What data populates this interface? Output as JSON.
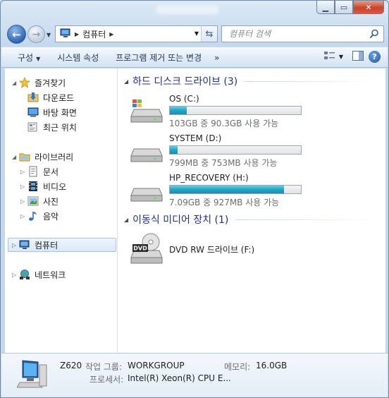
{
  "navigation": {
    "back_icon": "arrow-left",
    "forward_icon": "arrow-right",
    "address_crumb": "컴퓨터",
    "search_placeholder": "컴퓨터 검색"
  },
  "command_bar": {
    "organize": "구성",
    "system_properties": "시스템 속성",
    "uninstall_program": "프로그램 제거 또는 변경",
    "more": "»"
  },
  "nav_pane": {
    "favorites": {
      "label": "즐겨찾기",
      "items": [
        "다운로드",
        "바탕 화면",
        "최근 위치"
      ]
    },
    "libraries": {
      "label": "라이브러리",
      "items": [
        "문서",
        "비디오",
        "사진",
        "음악"
      ]
    },
    "computer": "컴퓨터",
    "network": "네트워크"
  },
  "groups": {
    "hard_disks": {
      "title": "하드 디스크 드라이브 (3)",
      "drives": [
        {
          "name": "OS (C:)",
          "info": "103GB 중 90.3GB 사용 가능",
          "used_fraction": 0.13
        },
        {
          "name": "SYSTEM (D:)",
          "info": "799MB 중 753MB 사용 가능",
          "used_fraction": 0.06
        },
        {
          "name": "HP_RECOVERY (H:)",
          "info": "7.09GB 중 927MB 사용 가능",
          "used_fraction": 0.87
        }
      ]
    },
    "removable": {
      "title": "이동식 미디어 장치 (1)",
      "drives": [
        {
          "name": "DVD RW 드라이브 (F:)",
          "badge": "DVD"
        }
      ]
    }
  },
  "details": {
    "computer_name": "Z620",
    "workgroup_label": "작업 그룹:",
    "workgroup_value": "WORKGROUP",
    "memory_label": "메모리:",
    "memory_value": "16.0GB",
    "processor_label": "프로세서:",
    "processor_value": "Intel(R) Xeon(R) CPU E..."
  },
  "colors": {
    "group_title": "#1e3287",
    "usage_bar": "#20a5c4",
    "close_button": "#c8442b"
  }
}
